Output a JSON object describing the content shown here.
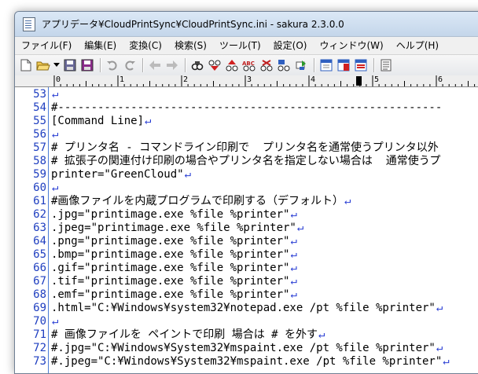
{
  "window": {
    "title": "アプリデータ¥CloudPrintSync¥CloudPrintSync.ini - sakura 2.3.0.0"
  },
  "menu": [
    "ファイル(F)",
    "編集(E)",
    "変換(C)",
    "検索(S)",
    "ツール(T)",
    "設定(O)",
    "ウィンドウ(W)",
    "ヘルプ(H)"
  ],
  "toolbar_icons": [
    "new-file-icon",
    "open-folder-icon",
    "dropdown-arrow-icon",
    "save-icon",
    "save-as-icon",
    "undo-icon",
    "redo-icon",
    "jump-back-icon",
    "jump-forward-icon",
    "search-icon",
    "find-prev-icon",
    "find-next-icon",
    "replace-icon",
    "clear-marks-icon",
    "grep-icon",
    "compare-icon",
    "split-left-icon",
    "split-right-icon",
    "outline-icon"
  ],
  "ruler": {
    "labels": [
      "0",
      "1",
      "2",
      "3",
      "4",
      "5",
      "6"
    ]
  },
  "eol_mark": "↵",
  "lines": [
    {
      "n": "53",
      "text": "",
      "eol": true
    },
    {
      "n": "54",
      "text": "#----------------------------------------------------------",
      "eol": false
    },
    {
      "n": "55",
      "text": "[Command Line]",
      "eol": true
    },
    {
      "n": "56",
      "text": "",
      "eol": true
    },
    {
      "n": "57",
      "text": "# プリンタ名 - コマンドライン印刷で  プリンタ名を通常使うプリンタ以外",
      "eol": false
    },
    {
      "n": "58",
      "text": "# 拡張子の関連付け印刷の場合やプリンタ名を指定しない場合は  通常使うプ",
      "eol": false
    },
    {
      "n": "59",
      "text": "printer=\"GreenCloud\"",
      "eol": true
    },
    {
      "n": "60",
      "text": "",
      "eol": true
    },
    {
      "n": "61",
      "text": "#画像ファイルを内蔵プログラムで印刷する（デフォルト）",
      "eol": true
    },
    {
      "n": "62",
      "text": ".jpg=\"printimage.exe %file %printer\"",
      "eol": true
    },
    {
      "n": "63",
      "text": ".jpeg=\"printimage.exe %file %printer\"",
      "eol": true
    },
    {
      "n": "64",
      "text": ".png=\"printimage.exe %file %printer\"",
      "eol": true
    },
    {
      "n": "65",
      "text": ".bmp=\"printimage.exe %file %printer\"",
      "eol": true
    },
    {
      "n": "66",
      "text": ".gif=\"printimage.exe %file %printer\"",
      "eol": true
    },
    {
      "n": "67",
      "text": ".tif=\"printimage.exe %file %printer\"",
      "eol": true
    },
    {
      "n": "68",
      "text": ".emf=\"printimage.exe %file %printer\"",
      "eol": true
    },
    {
      "n": "69",
      "text": ".html=\"C:¥Windows¥system32¥notepad.exe /pt %file %printer\"",
      "eol": true
    },
    {
      "n": "70",
      "text": "",
      "eol": true
    },
    {
      "n": "71",
      "text": "# 画像ファイルを ペイントで印刷 場合は # を外す",
      "eol": true
    },
    {
      "n": "72",
      "text": "#.jpg=\"C:¥Windows¥System32¥mspaint.exe /pt %file %printer\"",
      "eol": true
    },
    {
      "n": "73",
      "text": "#.jpeg=\"C:¥Windows¥System32¥mspaint.exe /pt %file %printer\"",
      "eol": true
    }
  ]
}
